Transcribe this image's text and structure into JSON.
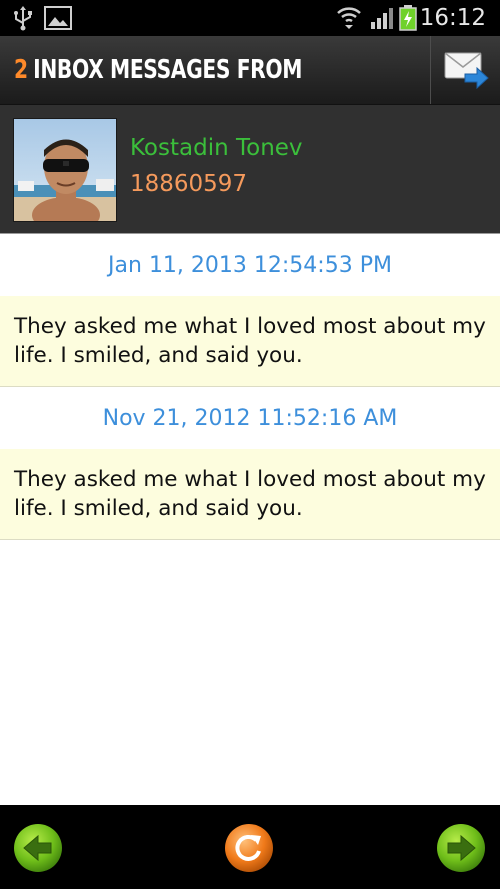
{
  "status_bar": {
    "time": "16:12",
    "icons": [
      "usb-icon",
      "image-icon",
      "wifi-icon",
      "signal-icon",
      "battery-charging-icon"
    ]
  },
  "header": {
    "count": "2",
    "title": "INBOX MESSAGES FROM",
    "compose_icon": "compose-message-icon"
  },
  "contact": {
    "name": "Kostadin Tonev",
    "number": "18860597"
  },
  "messages": [
    {
      "date": "Jan 11, 2013 12:54:53 PM",
      "text": "They asked me what I loved most about my life. I smiled, and said you."
    },
    {
      "date": "Nov 21, 2012 11:52:16 AM",
      "text": "They asked me what I loved most about my life. I smiled, and said you."
    }
  ],
  "bottom_bar": {
    "prev_icon": "arrow-left-icon",
    "refresh_icon": "refresh-icon",
    "next_icon": "arrow-right-icon"
  },
  "colors": {
    "accent_orange": "#ff8a2a",
    "name_green": "#3bbf3b",
    "number_orange": "#f59a5c",
    "date_blue": "#3d8fdb",
    "message_bg": "#fdfdde"
  }
}
